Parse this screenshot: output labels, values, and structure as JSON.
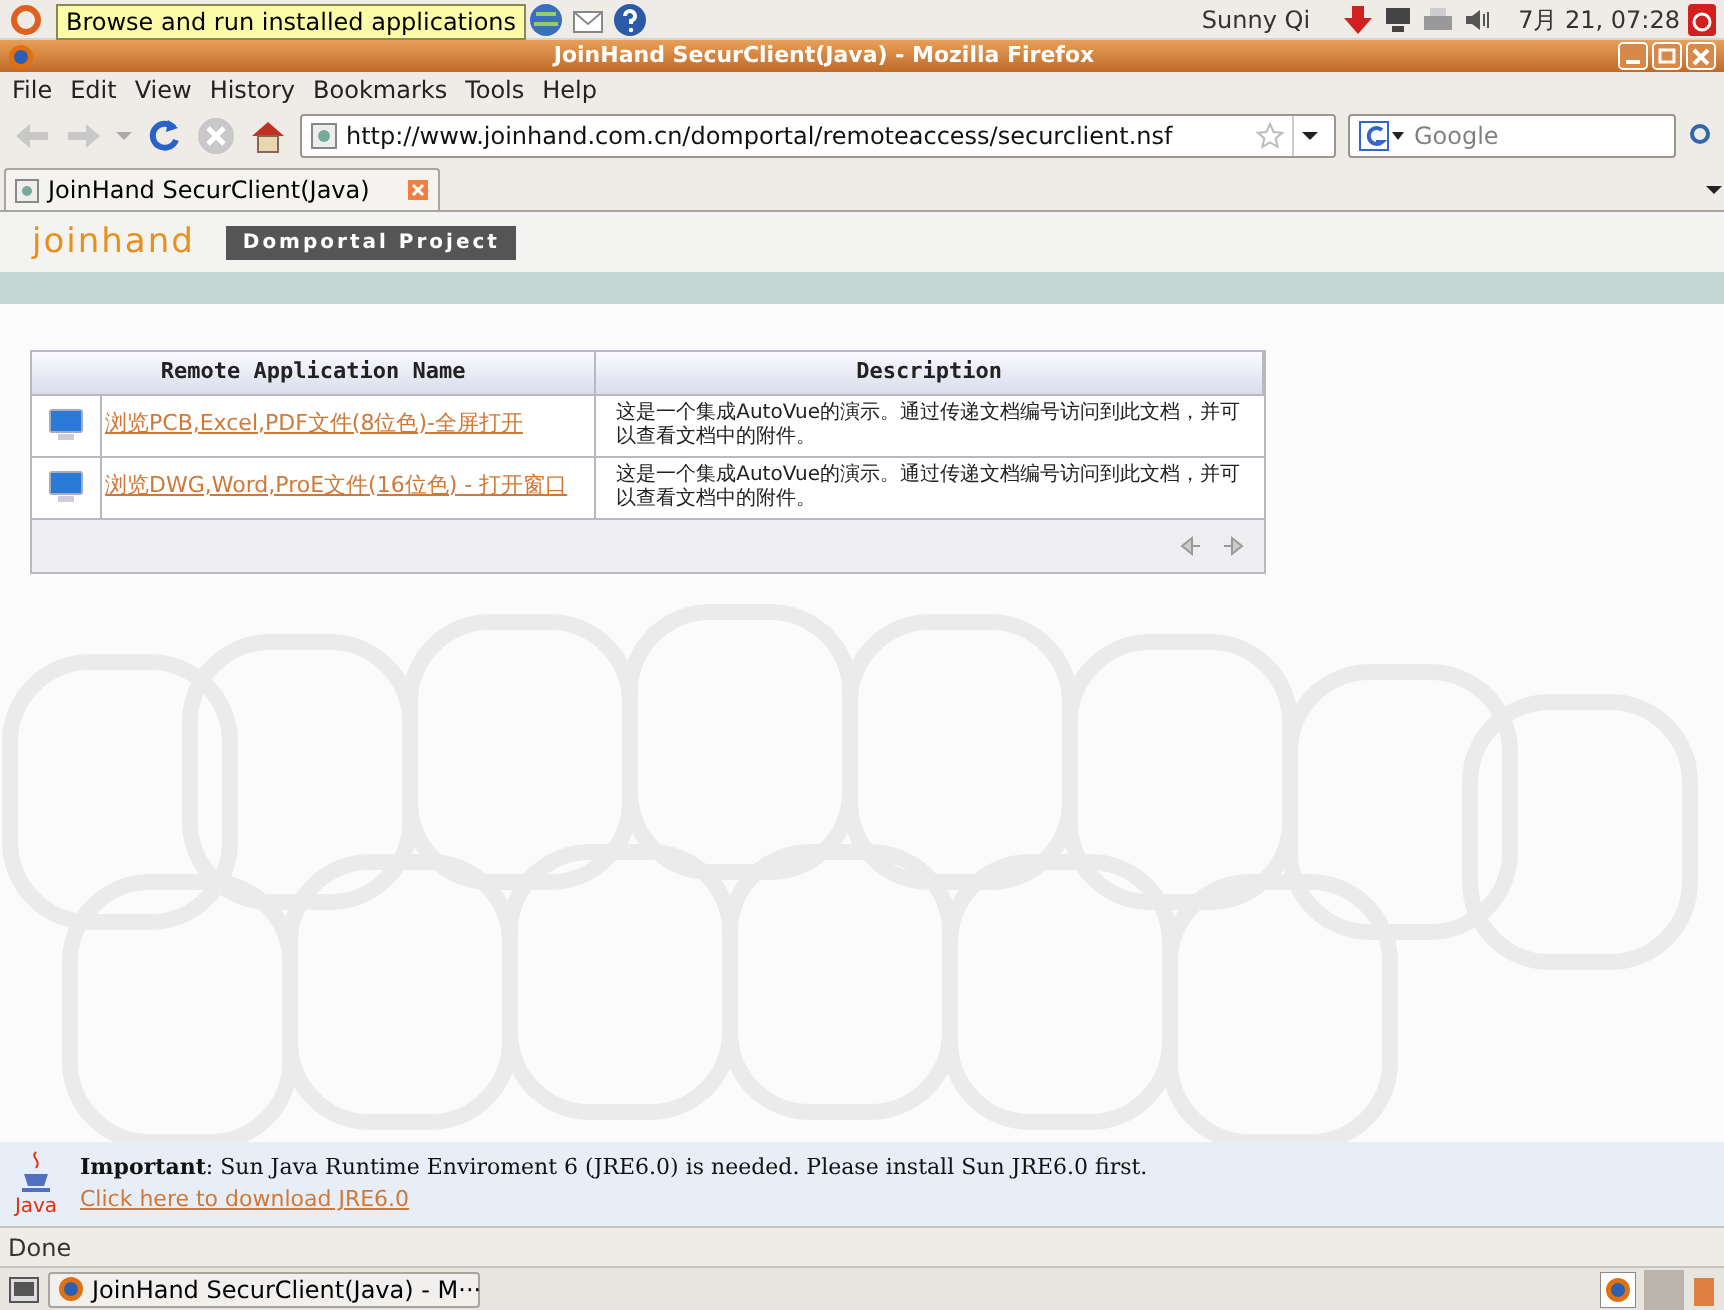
{
  "top_panel": {
    "tooltip": "Browse and run installed applications",
    "user": "Sunny Qi",
    "clock": "7月 21, 07:28"
  },
  "window": {
    "title": "JoinHand SecurClient(Java) - Mozilla Firefox"
  },
  "menu": [
    "File",
    "Edit",
    "View",
    "History",
    "Bookmarks",
    "Tools",
    "Help"
  ],
  "toolbar": {
    "url": "http://www.joinhand.com.cn/domportal/remoteaccess/securclient.nsf",
    "search_placeholder": "Google"
  },
  "tabs": [
    {
      "label": "JoinHand SecurClient(Java)",
      "selected": true
    }
  ],
  "page": {
    "logo": "joinhand",
    "project": "Domportal Project",
    "table": {
      "columns": [
        "Remote Application Name",
        "Description"
      ],
      "rows": [
        {
          "name": "浏览PCB,Excel,PDF文件(8位色)-全屏打开",
          "description": "这是一个集成AutoVue的演示。通过传递文档编号访问到此文档，并可以查看文档中的附件。"
        },
        {
          "name": "浏览DWG,Word,ProE文件(16位色) - 打开窗口",
          "description": "这是一个集成AutoVue的演示。通过传递文档编号访问到此文档，并可以查看文档中的附件。"
        }
      ]
    },
    "java_notice": {
      "text": "**Important**: Sun Java Runtime Enviroment 6 (JRE6.0) is needed. Please install Sun JRE6.0 first.",
      "link": "Click here to download JRE6.0",
      "icon_label": "Java"
    }
  },
  "status_bar": "Done",
  "taskbar": [
    {
      "label": "JoinHand SecurClient(Java) - M···",
      "selected": false
    }
  ]
}
